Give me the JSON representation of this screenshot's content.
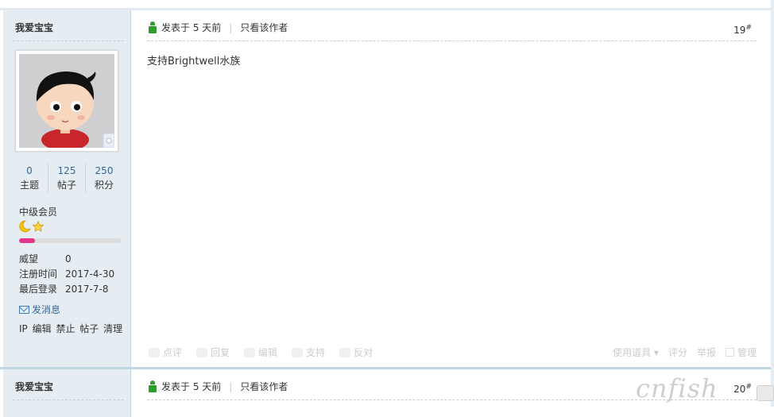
{
  "posts": [
    {
      "author": "我爱宝宝",
      "post_info": "发表于 5 天前",
      "only_author": "只看该作者",
      "floor_num": "19",
      "floor_sup": "#",
      "content": "支持Brightwell水族"
    },
    {
      "author": "我爱宝宝",
      "post_info": "发表于 5 天前",
      "only_author": "只看该作者",
      "floor_num": "20",
      "floor_sup": "#"
    }
  ],
  "profile": {
    "stats": [
      {
        "value": "0",
        "label": "主题"
      },
      {
        "value": "125",
        "label": "帖子"
      },
      {
        "value": "250",
        "label": "积分"
      }
    ],
    "rank": "中级会员",
    "rank_icons": "🌙⭐",
    "progress_fraction": 0.16,
    "info": [
      {
        "key": "威望",
        "value": "0"
      },
      {
        "key": "注册时间",
        "value": "2017-4-30"
      },
      {
        "key": "最后登录",
        "value": "2017-7-8"
      }
    ],
    "send_message": "发消息",
    "admin_links": [
      "IP",
      "编辑",
      "禁止",
      "帖子",
      "清理"
    ]
  },
  "actions": {
    "comment": "点评",
    "reply": "回复",
    "edit": "编辑",
    "support": "支持",
    "oppose": "反对",
    "tools": "使用道具",
    "rate": "评分",
    "report": "举报",
    "manage": "管理"
  },
  "watermark": "cnfish",
  "colors": {
    "sidebar_bg": "#e5edf2",
    "border": "#c2d5e3",
    "link": "#336699",
    "progress": "#e1368c",
    "icon_green": "#2d9b2d"
  }
}
